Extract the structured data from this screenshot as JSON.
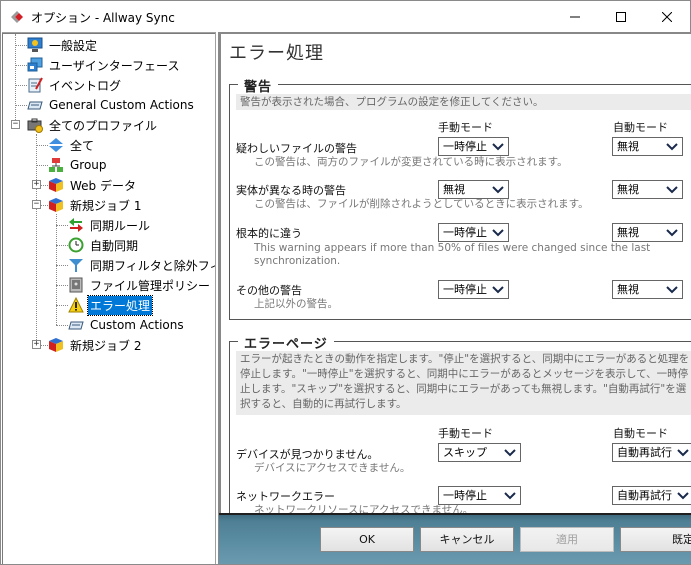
{
  "window": {
    "title": "オプション - Allway Sync",
    "controls": {
      "minimize": "minimize",
      "maximize": "maximize",
      "close": "close"
    }
  },
  "tree": {
    "items": [
      {
        "label": "一般設定",
        "icon": "monitor-gear-icon"
      },
      {
        "label": "ユーザインターフェース",
        "icon": "windows-icon"
      },
      {
        "label": "イベントログ",
        "icon": "log-book-icon"
      },
      {
        "label": "General Custom Actions",
        "icon": "custom-actions-icon"
      },
      {
        "label": "全てのプロファイル",
        "icon": "profiles-briefcase-icon",
        "expanded": true
      },
      {
        "label": "全て",
        "icon": "up-down-arrows-icon"
      },
      {
        "label": "Group",
        "icon": "group-hierarchy-icon"
      },
      {
        "label": "Web データ",
        "icon": "cube-icon",
        "expanded": false
      },
      {
        "label": "新規ジョブ 1",
        "icon": "cube-icon",
        "expanded": true
      },
      {
        "label": "同期ルール",
        "icon": "sync-arrows-icon"
      },
      {
        "label": "自動同期",
        "icon": "clock-icon"
      },
      {
        "label": "同期フィルタと除外フィルタ",
        "icon": "filter-funnel-icon"
      },
      {
        "label": "ファイル管理ポリシー",
        "icon": "safe-icon"
      },
      {
        "label": "エラー処理",
        "icon": "warning-icon",
        "selected": true
      },
      {
        "label": "Custom Actions",
        "icon": "custom-actions-icon"
      },
      {
        "label": "新規ジョブ 2",
        "icon": "cube-icon",
        "expanded": false
      }
    ]
  },
  "page": {
    "title": "エラー処理",
    "warnings": {
      "legend": "警告",
      "description": "警告が表示された場合、プログラムの設定を修正してください。",
      "manual_header": "手動モード",
      "auto_header": "自動モード",
      "rows": [
        {
          "label": "疑わしいファイルの警告",
          "sub": "この警告は、両方のファイルが変更されている時に表示されます。",
          "manual": "一時停止",
          "auto": "無視"
        },
        {
          "label": "実体が異なる時の警告",
          "sub": "この警告は、ファイルが削除されようとしているときに表示されます。",
          "manual": "無視",
          "auto": "無視"
        },
        {
          "label": "根本的に違う",
          "sub": "This warning appears if more than 50% of files were changed since the last synchronization.",
          "manual": "一時停止",
          "auto": "無視"
        },
        {
          "label": "その他の警告",
          "sub": "上記以外の警告。",
          "manual": "一時停止",
          "auto": "無視"
        }
      ]
    },
    "errors": {
      "legend": "エラーページ",
      "description": "エラーが起きたときの動作を指定します。\"停止\"を選択すると、同期中にエラーがあると処理を停止します。\"一時停止\"を選択すると、同期中にエラーがあるとメッセージを表示して、一時停止します。\"スキップ\"を選択すると、同期中にエラーがあっても無視します。\"自動再試行\"を選択すると、自動的に再試行します。",
      "manual_header": "手動モード",
      "auto_header": "自動モード",
      "rows": [
        {
          "label": "デバイスが見つかりません。",
          "sub": "デバイスにアクセスできません。",
          "manual": "スキップ",
          "auto": "自動再試行"
        },
        {
          "label": "ネットワークエラー",
          "sub": "ネットワークリソースにアクセスできません。",
          "manual": "一時停止",
          "auto": "自動再試行"
        }
      ]
    }
  },
  "buttons": {
    "ok": "OK",
    "cancel": "キャンセル",
    "apply": "適用",
    "defaults": "既定値"
  },
  "colors": {
    "selection": "#0078d7",
    "bottom_bar": "#5d8fa4"
  }
}
